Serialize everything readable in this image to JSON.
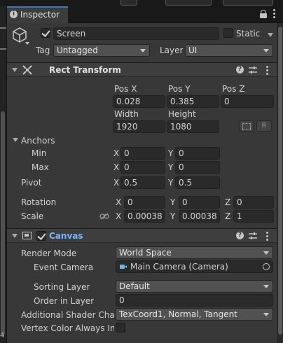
{
  "tab": {
    "title": "Inspector"
  },
  "gameobject": {
    "name": "Screen",
    "static_label": "Static",
    "tag_label": "Tag",
    "tag_value": "Untagged",
    "layer_label": "Layer",
    "layer_value": "UI"
  },
  "rect_transform": {
    "title": "Rect Transform",
    "pos_x_label": "Pos X",
    "pos_y_label": "Pos Y",
    "pos_z_label": "Pos Z",
    "pos_x": "0.028",
    "pos_y": "0.385",
    "pos_z": "0",
    "width_label": "Width",
    "height_label": "Height",
    "width": "1920",
    "height": "1080",
    "raw_button": "R",
    "anchors_label": "Anchors",
    "min_label": "Min",
    "max_label": "Max",
    "min_x": "0",
    "min_y": "0",
    "max_x": "0",
    "max_y": "0",
    "pivot_label": "Pivot",
    "pivot_x": "0.5",
    "pivot_y": "0.5",
    "rotation_label": "Rotation",
    "rot_x": "0",
    "rot_y": "0",
    "rot_z": "0",
    "scale_label": "Scale",
    "scale_x": "0.00038",
    "scale_y": "0.00038",
    "scale_z": "1",
    "x": "X",
    "y": "Y",
    "z": "Z"
  },
  "canvas": {
    "title": "Canvas",
    "render_mode_label": "Render Mode",
    "render_mode": "World Space",
    "event_camera_label": "Event Camera",
    "event_camera": "Main Camera (Camera)",
    "sorting_layer_label": "Sorting Layer",
    "sorting_layer": "Default",
    "order_label": "Order in Layer",
    "order": "0",
    "shader_label": "Additional Shader Chan",
    "shader_value": "TexCoord1, Normal, Tangent",
    "vertex_label": "Vertex Color Always In G"
  },
  "left_strip": {
    "number": "4"
  },
  "colors": {
    "accent": "#3a79bb",
    "panel": "#383838",
    "field": "#2a2a2a",
    "canvas_title": "#7ab4ff"
  }
}
